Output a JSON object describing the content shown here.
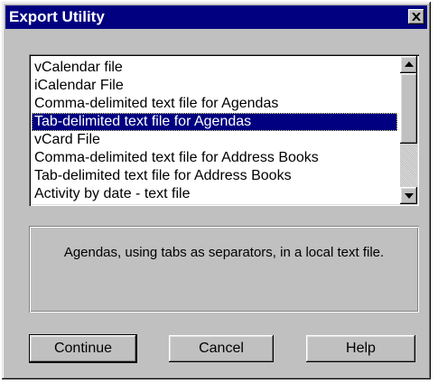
{
  "window": {
    "title": "Export Utility",
    "close_icon": "close-x-icon"
  },
  "listbox": {
    "items": [
      {
        "label": "vCalendar file",
        "selected": false
      },
      {
        "label": "iCalendar File",
        "selected": false
      },
      {
        "label": "Comma-delimited text file for Agendas",
        "selected": false
      },
      {
        "label": "Tab-delimited text file for Agendas",
        "selected": true
      },
      {
        "label": "vCard File",
        "selected": false
      },
      {
        "label": "Comma-delimited text file for Address Books",
        "selected": false
      },
      {
        "label": "Tab-delimited text file for Address Books",
        "selected": false
      },
      {
        "label": "Activity by date - text file",
        "selected": false
      }
    ],
    "scroll_up_icon": "arrow-up-icon",
    "scroll_down_icon": "arrow-down-icon"
  },
  "description": "Agendas, using tabs as separators, in a local text file.",
  "buttons": {
    "continue": "Continue",
    "cancel": "Cancel",
    "help": "Help"
  },
  "colors": {
    "title_bar": "#000080",
    "selection": "#000080",
    "face": "#c0c0c0"
  }
}
